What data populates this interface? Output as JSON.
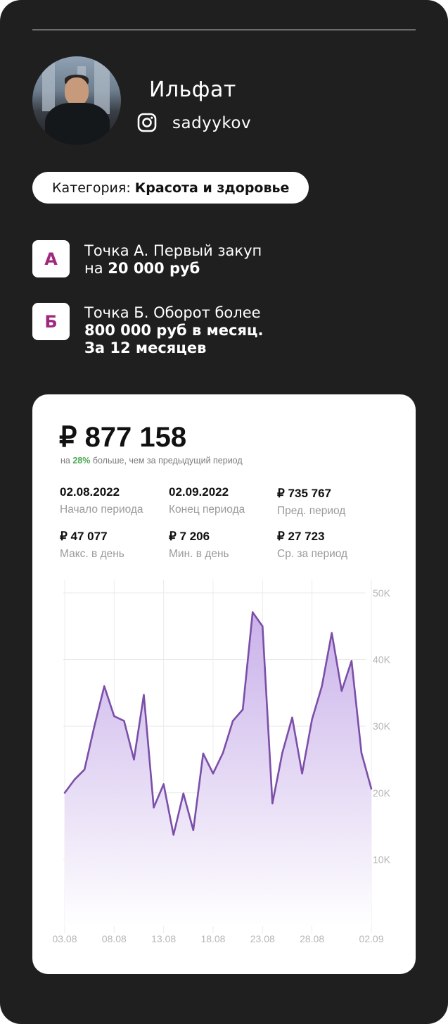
{
  "profile": {
    "name": "Ильфат",
    "instagram_handle": "sadyykov",
    "icons": {
      "instagram": "instagram-icon",
      "avatar": "profile-photo"
    }
  },
  "category": {
    "label": "Категория:",
    "value": "Красота и здоровье"
  },
  "points": [
    {
      "badge": "А",
      "line1": "Точка А. Первый закуп",
      "line2_prefix": "на ",
      "line2_bold": "20 000 руб",
      "line3_bold": ""
    },
    {
      "badge": "Б",
      "line1": "Точка Б. Оборот более",
      "line2_prefix": "",
      "line2_bold": "800 000 руб в месяц.",
      "line3_bold": "За 12 месяцев"
    }
  ],
  "revenue": {
    "total": "₽ 877 158",
    "subtitle_prefix": "на ",
    "subtitle_pct": "28%",
    "subtitle_suffix": " больше, чем за предыдущий период",
    "stats": [
      {
        "value": "02.08.2022",
        "label": "Начало периода"
      },
      {
        "value": "02.09.2022",
        "label": "Конец периода"
      },
      {
        "value": "₽ 735 767",
        "label": "Пред. период"
      },
      {
        "value": "₽ 47 077",
        "label": "Макс. в день"
      },
      {
        "value": "₽ 7 206",
        "label": "Мин. в день"
      },
      {
        "value": "₽ 27 723",
        "label": "Ср. за период"
      }
    ]
  },
  "colors": {
    "background": "#1f1f1f",
    "accent_badge_text": "#a0297e",
    "line": "#7b4fa8",
    "area_top": "#c7aee9",
    "positive": "#4caa55"
  },
  "chart_data": {
    "type": "area",
    "x_tick_labels": [
      "03.08",
      "08.08",
      "13.08",
      "18.08",
      "23.08",
      "28.08",
      "02.09"
    ],
    "y_tick_labels": [
      "10K",
      "20K",
      "30K",
      "40K",
      "50K"
    ],
    "ylim": [
      0,
      52000
    ],
    "grid": true,
    "series": [
      {
        "values": [
          20000,
          22000,
          23500,
          30000,
          36000,
          31500,
          30800,
          25000,
          34700,
          17800,
          21300,
          13700,
          19900,
          14400,
          25900,
          22900,
          26000,
          30800,
          32500,
          47100,
          45000,
          18400,
          26000,
          31300,
          22900,
          31000,
          36000,
          44000,
          35300,
          39800,
          26000,
          20600
        ]
      }
    ]
  }
}
